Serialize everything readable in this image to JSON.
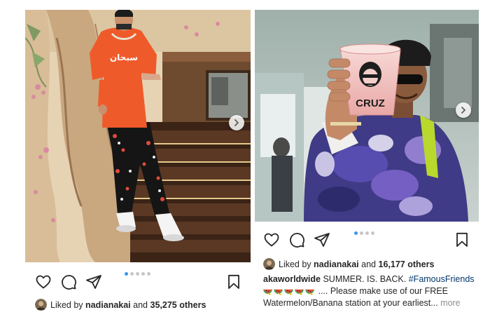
{
  "left_post": {
    "slide_count": 5,
    "active_slide": 0,
    "liked_by_prefix": "Liked by",
    "liked_by_user": "nadianakai",
    "and_text": "and",
    "likes_others": "35,275 others",
    "icons": [
      "heart-icon",
      "comment-icon",
      "share-icon",
      "bookmark-icon",
      "chevron-right-icon"
    ],
    "shirt_text": "سبحان"
  },
  "right_post": {
    "slide_count": 4,
    "active_slide": 0,
    "liked_by_prefix": "Liked by",
    "liked_by_user": "nadianakai",
    "and_text": "and",
    "likes_others": "16,177 others",
    "caption_user": "akaworldwide",
    "caption_text": "SUMMER. IS. BACK.",
    "caption_hashtag": "#FamousFriends",
    "caption_line2": ".... Please make use of our FREE",
    "caption_line3": "Watermelon/Banana station at your earliest...",
    "more_label": "more",
    "cup_text": "CRUZ",
    "emoji_count": 5
  },
  "colors": {
    "link_blue": "#00376b",
    "dot_active": "#3897f0",
    "shirt_orange": "#ef5a2a"
  }
}
